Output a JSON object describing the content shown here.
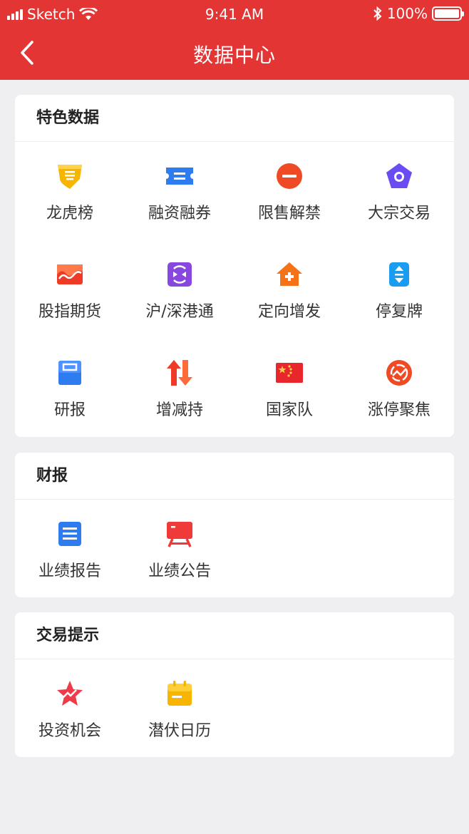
{
  "status": {
    "carrier": "Sketch",
    "time": "9:41 AM",
    "battery": "100%"
  },
  "nav": {
    "title": "数据中心"
  },
  "sections": [
    {
      "title": "特色数据",
      "items": [
        {
          "label": "龙虎榜",
          "icon": "shield-list-icon",
          "color": "#f7b500"
        },
        {
          "label": "融资融券",
          "icon": "ticket-icon",
          "color": "#2f7bf0"
        },
        {
          "label": "限售解禁",
          "icon": "minus-circle-icon",
          "color": "#f04a24"
        },
        {
          "label": "大宗交易",
          "icon": "pentagon-icon",
          "color": "#6a4cf2"
        },
        {
          "label": "股指期货",
          "icon": "trend-chart-icon",
          "color": "#f03a28"
        },
        {
          "label": "沪/深港通",
          "icon": "exchange-icon",
          "color": "#8848e0"
        },
        {
          "label": "定向增发",
          "icon": "house-plus-icon",
          "color": "#f57316"
        },
        {
          "label": "停复牌",
          "icon": "updown-icon",
          "color": "#1a9df0"
        },
        {
          "label": "研报",
          "icon": "report-icon",
          "color": "#2f7bf0"
        },
        {
          "label": "增减持",
          "icon": "updown-arrows-icon",
          "color": "#f03a28"
        },
        {
          "label": "国家队",
          "icon": "flag-icon",
          "color": "#e8262b"
        },
        {
          "label": "涨停聚焦",
          "icon": "focus-trend-icon",
          "color": "#f04a24"
        }
      ]
    },
    {
      "title": "财报",
      "items": [
        {
          "label": "业绩报告",
          "icon": "document-icon",
          "color": "#2f7bf0"
        },
        {
          "label": "业绩公告",
          "icon": "billboard-icon",
          "color": "#f03a3a"
        }
      ]
    },
    {
      "title": "交易提示",
      "items": [
        {
          "label": "投资机会",
          "icon": "star-trend-icon",
          "color": "#f03a4a"
        },
        {
          "label": "潜伏日历",
          "icon": "calendar-icon",
          "color": "#f7b500"
        }
      ]
    }
  ]
}
